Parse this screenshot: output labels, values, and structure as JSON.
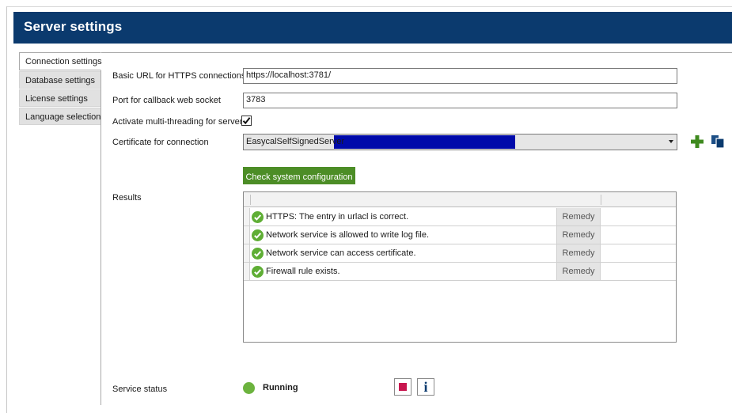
{
  "header": {
    "title": "Server settings",
    "background": "#0b3a6e"
  },
  "tabs": [
    {
      "label": "Connection settings",
      "active": true
    },
    {
      "label": "Database settings",
      "active": false
    },
    {
      "label": "License settings",
      "active": false
    },
    {
      "label": "Language selection",
      "active": false
    }
  ],
  "form": {
    "https_url_label": "Basic URL for HTTPS connections",
    "https_url_value": "https://localhost:3781/",
    "port_label": "Port for callback web socket",
    "port_value": "3783",
    "multithreading_label": "Activate multi-threading for server",
    "multithreading_checked": true,
    "certificate_label": "Certificate for connection",
    "certificate_value": "EasycalSelfSignedServer",
    "certificate_add_icon": "plus-icon",
    "certificate_copy_icon": "copy-icon"
  },
  "check_button": {
    "label": "Check system configuration",
    "color": "#4c8d26"
  },
  "results": {
    "label": "Results",
    "rows": [
      {
        "status": "ok",
        "icon": "check-circle-icon",
        "text": "HTTPS: The entry in urlacl is correct.",
        "action": "Remedy"
      },
      {
        "status": "ok",
        "icon": "check-circle-icon",
        "text": "Network service is allowed to write log file.",
        "action": "Remedy"
      },
      {
        "status": "ok",
        "icon": "check-circle-icon",
        "text": "Network service can access certificate.",
        "action": "Remedy"
      },
      {
        "status": "ok",
        "icon": "check-circle-icon",
        "text": "Firewall rule exists.",
        "action": "Remedy"
      }
    ]
  },
  "service": {
    "label": "Service status",
    "status_text": "Running",
    "status_color": "#6cb33e",
    "stop_icon": "stop-icon",
    "info_icon": "info-icon",
    "info_glyph": "i"
  }
}
